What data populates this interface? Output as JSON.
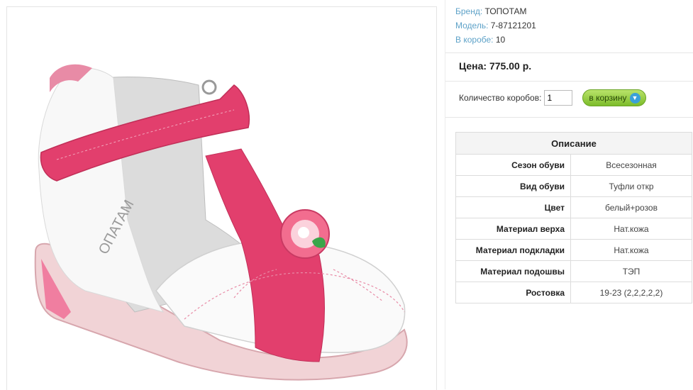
{
  "product": {
    "brand_label": "Бренд:",
    "brand_value": "ТОПОТАМ",
    "model_label": "Модель:",
    "model_value": "7-87121201",
    "box_label": "В коробе:",
    "box_value": "10",
    "price": "Цена: 775.00 р."
  },
  "order": {
    "qty_label": "Количество коробов:",
    "qty_value": "1",
    "cart_label": "в корзину"
  },
  "description": {
    "title": "Описание",
    "rows": [
      {
        "label": "Сезон обуви",
        "value": "Всесезонная"
      },
      {
        "label": "Вид обуви",
        "value": "Туфли откр"
      },
      {
        "label": "Цвет",
        "value": "белый+розов"
      },
      {
        "label": "Материал верха",
        "value": "Нат.кожа"
      },
      {
        "label": "Материал подкладки",
        "value": "Нат.кожа"
      },
      {
        "label": "Материал подошвы",
        "value": "ТЭП"
      },
      {
        "label": "Ростовка",
        "value": "19-23 (2,2,2,2,2)"
      }
    ]
  },
  "colors": {
    "accent_link": "#5ea2c8",
    "button_green": "#7cbc2a",
    "shoe_pink": "#e23f6d"
  }
}
